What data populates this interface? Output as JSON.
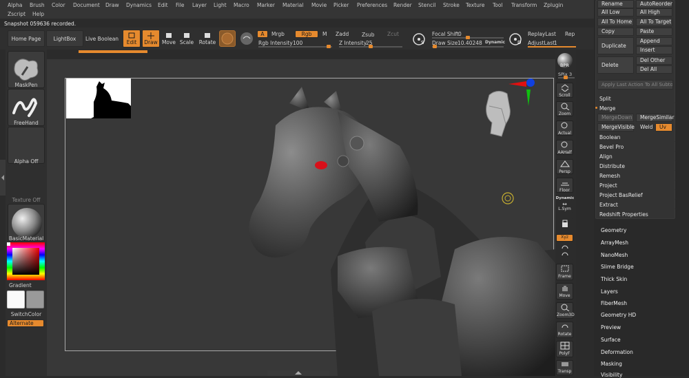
{
  "menu": {
    "row1": [
      "Alpha",
      "Brush",
      "Color",
      "Document",
      "Draw",
      "Dynamics",
      "Edit",
      "File",
      "Layer",
      "Light",
      "Macro",
      "Marker",
      "Material",
      "Movie",
      "Picker",
      "Preferences",
      "Render",
      "Stencil",
      "Stroke",
      "Texture",
      "Tool",
      "Transform",
      "Zplugin"
    ],
    "row2": [
      "Zscript",
      "Help"
    ]
  },
  "status": "Snapshot 059636 recorded.",
  "toolbar": {
    "home_page": "Home Page",
    "lightbox": "LightBox",
    "live_boolean": "Live Boolean",
    "edit": "Edit",
    "draw": "Draw",
    "move": "Move",
    "scale": "Scale",
    "rotate": "Rotate",
    "a": "A",
    "mrgb": "Mrgb",
    "rgb": "Rgb",
    "m": "M",
    "zadd": "Zadd",
    "zsub": "Zsub",
    "zcut": "Zcut",
    "rgb_intensity_label": "Rgb Intensity",
    "rgb_intensity_value": "100",
    "z_intensity_label": "Z Intensity",
    "z_intensity_value": "25",
    "focal_shift_label": "Focal Shift",
    "focal_shift_value": "0",
    "draw_size_label": "Draw Size",
    "draw_size_value": "10.40248",
    "dynamic": "Dynamic",
    "replay_last": "ReplayLast",
    "rep": "Rep",
    "adjust_last_label": "AdjustLast",
    "adjust_last_value": "1",
    "s_icon_letter": "S",
    "d_icon_letter": "D"
  },
  "left_shelf": {
    "tiles": [
      "MaskPen",
      "FreeHand",
      "Alpha Off",
      "Texture Off",
      "BasicMaterial"
    ],
    "gradient": "Gradient",
    "switch_color": "SwitchColor",
    "alternate": "Alternate"
  },
  "right_shelf": {
    "bpr": "BPR",
    "spix_label": "SPix",
    "spix_value": "3",
    "buttons": [
      "Scroll",
      "Zoom",
      "Actual",
      "AAHalf",
      "Persp",
      "Floor",
      "L.Sym",
      "Xyz",
      "Frame",
      "Move",
      "Zoom3D",
      "Rotate",
      "PolyF",
      "Transp"
    ],
    "dynamic": "Dynamic"
  },
  "subtool_panel": {
    "rename": "Rename",
    "auto_reorder": "AutoReorder",
    "all_low": "All Low",
    "all_high": "All High",
    "all_to_home": "All To Home",
    "all_to_target": "All To Target",
    "copy": "Copy",
    "paste": "Paste",
    "duplicate": "Duplicate",
    "append": "Append",
    "insert": "Insert",
    "delete": "Delete",
    "del_other": "Del Other",
    "del_all": "Del All",
    "apply_last": "Apply Last Action To All Subtool",
    "split": "Split",
    "merge": "Merge",
    "merge_down": "MergeDown",
    "merge_similar": "MergeSimilar",
    "merge_visible": "MergeVisible",
    "weld": "Weld",
    "uv": "Uv",
    "sections": [
      "Boolean",
      "Bevel Pro",
      "Align",
      "Distribute",
      "Remesh",
      "Project",
      "Project BasRelief",
      "Extract",
      "Redshift Properties"
    ]
  },
  "tool_sections": [
    "Geometry",
    "ArrayMesh",
    "NanoMesh",
    "Slime Bridge",
    "Thick Skin",
    "Layers",
    "FiberMesh",
    "Geometry HD",
    "Preview",
    "Surface",
    "Deformation",
    "Masking",
    "Visibility"
  ],
  "colors": {
    "accent": "#e68a2e",
    "eye": "#d8101a"
  }
}
